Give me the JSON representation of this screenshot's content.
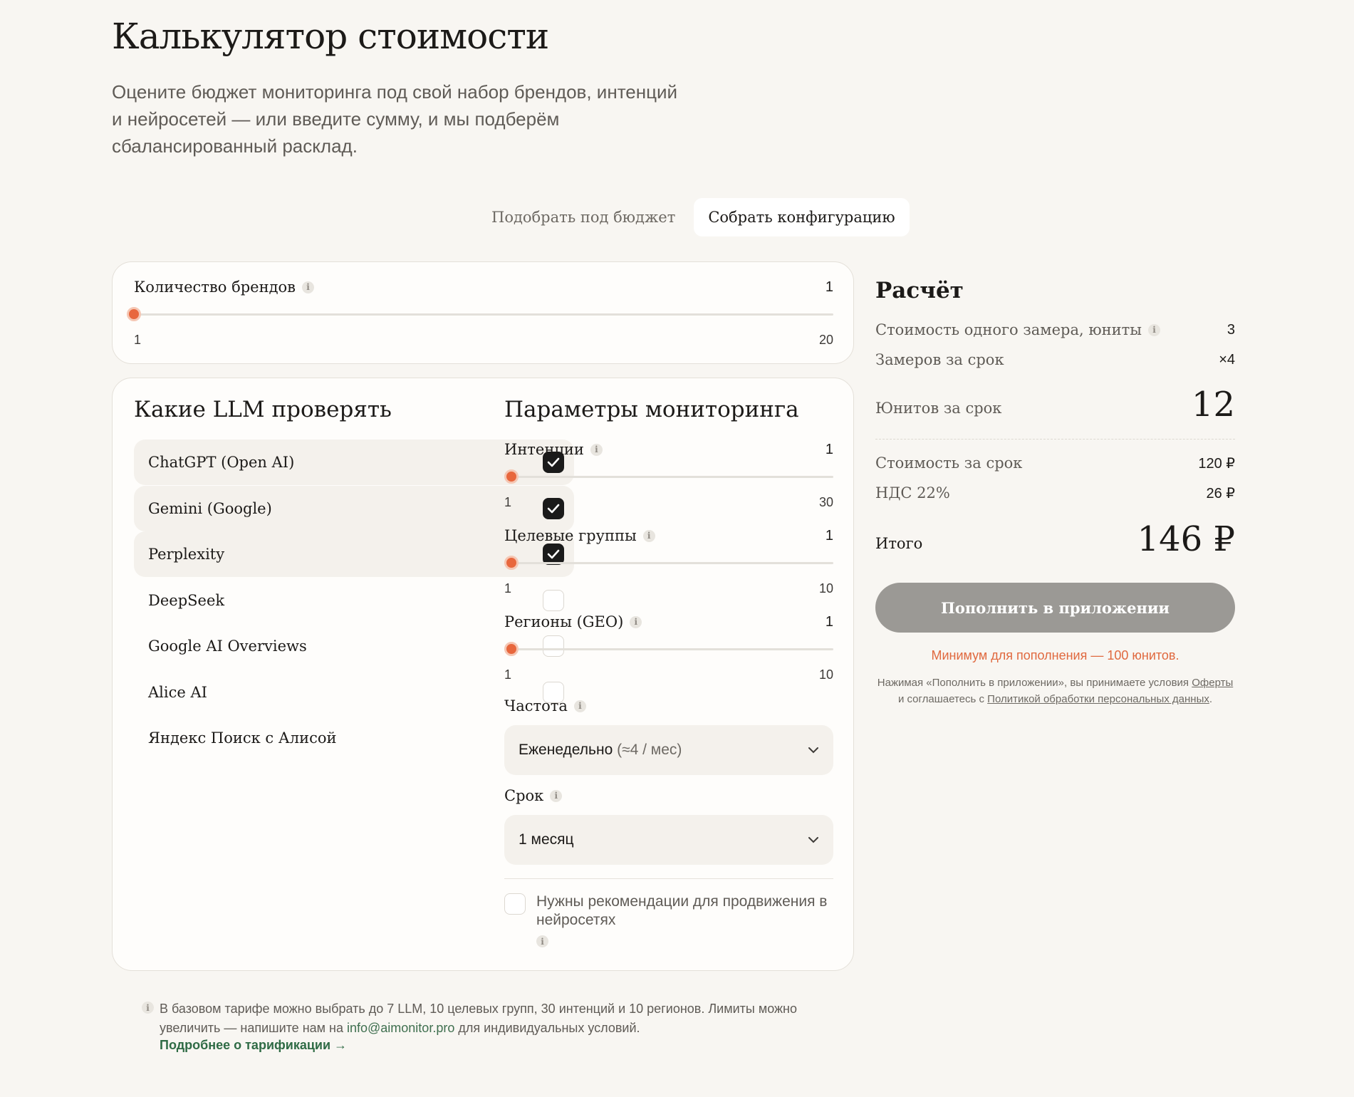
{
  "header": {
    "title": "Калькулятор стоимости",
    "subtitle_line1": "Оцените бюджет мониторинга под свой набор брендов, интенций",
    "subtitle_line2": "и нейросетей — или введите сумму, и мы подберём",
    "subtitle_line3": "сбалансированный расклад."
  },
  "mode_switch": {
    "budget_label": "Подобрать под бюджет",
    "config_label": "Собрать конфигурацию",
    "active": "config"
  },
  "brands": {
    "label": "Количество брендов",
    "value": "1",
    "min": "1",
    "max": "20"
  },
  "llm": {
    "title": "Какие LLM проверять",
    "items": [
      {
        "name": "ChatGPT (Open AI)",
        "checked": true
      },
      {
        "name": "Gemini (Google)",
        "checked": true
      },
      {
        "name": "Perplexity",
        "checked": true
      },
      {
        "name": "DeepSeek",
        "checked": false
      },
      {
        "name": "Google AI Overviews",
        "checked": false
      },
      {
        "name": "Alice AI",
        "checked": false
      },
      {
        "name": "Яндекс Поиск с Алисой",
        "checked": false
      }
    ]
  },
  "params": {
    "title": "Параметры мониторинга",
    "intents": {
      "label": "Интенции",
      "value": "1",
      "min": "1",
      "max": "30"
    },
    "groups": {
      "label": "Целевые группы",
      "value": "1",
      "min": "1",
      "max": "10"
    },
    "regions": {
      "label": "Регионы (GEO)",
      "value": "1",
      "min": "1",
      "max": "10"
    },
    "frequency": {
      "label": "Частота",
      "selected": "Еженедельно",
      "selected_note": "(≈4 / мес)"
    },
    "term": {
      "label": "Срок",
      "selected": "1 месяц"
    },
    "recommendations": {
      "label_line1": "Нужны рекомендации для продвижения в",
      "label_line2": "нейросетях",
      "checked": false
    }
  },
  "calc": {
    "title": "Расчёт",
    "unit_cost_label": "Стоимость одного замера, юниты",
    "unit_cost_value": "3",
    "measures_label": "Замеров за срок",
    "measures_value": "×4",
    "units_label": "Юнитов за срок",
    "units_value": "12",
    "cost_label": "Стоимость за срок",
    "cost_value": "120 ₽",
    "vat_label": "НДС 22%",
    "vat_value": "26 ₽",
    "total_label": "Итого",
    "total_value": "146 ₽",
    "cta_label": "Пополнить в приложении",
    "min_note": "Минимум для пополнения — 100 юнитов.",
    "legal_part1": "Нажимая «Пополнить в приложении», вы принимаете условия",
    "legal_link1": "Оферты",
    "legal_part2": "и соглашаетесь с",
    "legal_link2": "Политикой обработки персональных данных",
    "legal_end": "."
  },
  "footer": {
    "note_part1": "В базовом тарифе можно выбрать до 7 LLM, 10 целевых групп, 30 интенций и 10 регионов. Лимиты можно увеличить — напишите нам на",
    "email": "info@aimonitor.pro",
    "note_part2": "для индивидуальных условий.",
    "more_link": "Подробнее о тарификации →"
  },
  "colors": {
    "accent": "#e8673d",
    "cta_disabled": "#9b9995",
    "link_green": "#2f6b45",
    "background": "#f8f6f2"
  },
  "icons": {
    "info": "info-icon",
    "check": "check-icon",
    "chevron": "chevron-down-icon"
  }
}
